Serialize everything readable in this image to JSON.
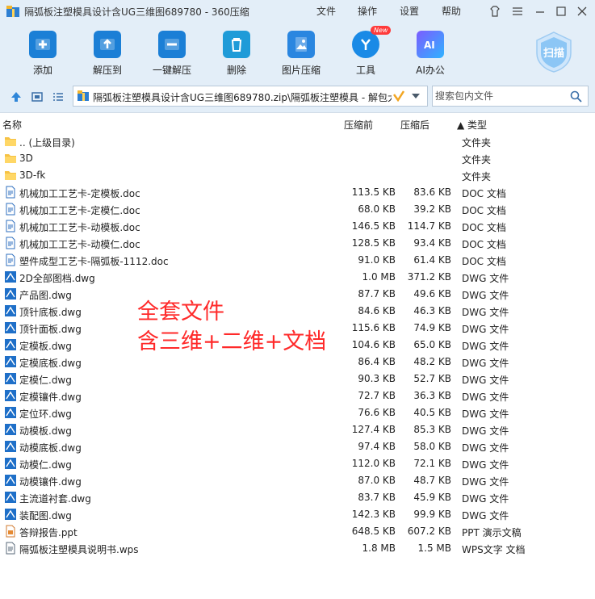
{
  "window": {
    "title": "隔弧板注塑模具设计含UG三维图689780 - 360压缩",
    "menus": [
      "文件",
      "操作",
      "设置",
      "帮助"
    ]
  },
  "toolbar": {
    "items": [
      {
        "label": "添加",
        "icon": "add-archive-icon"
      },
      {
        "label": "解压到",
        "icon": "extract-to-icon"
      },
      {
        "label": "一键解压",
        "icon": "one-click-extract-icon"
      },
      {
        "label": "删除",
        "icon": "delete-icon"
      },
      {
        "label": "图片压缩",
        "icon": "image-compress-icon"
      },
      {
        "label": "工具",
        "icon": "tools-icon",
        "badge": "New"
      },
      {
        "label": "AI办公",
        "icon": "ai-office-icon"
      }
    ],
    "scan_label": "扫描"
  },
  "address": {
    "path": "隔弧板注塑模具设计含UG三维图689780.zip\\隔弧板注塑模具 - 解包大",
    "search_placeholder": "搜索包内文件"
  },
  "columns": {
    "name": "名称",
    "size": "压缩前",
    "compressed": "压缩后",
    "type": "▲ 类型"
  },
  "files": [
    {
      "name": ".. (上级目录)",
      "size": "",
      "csize": "",
      "type": "文件夹",
      "kind": "folder"
    },
    {
      "name": "3D",
      "size": "",
      "csize": "",
      "type": "文件夹",
      "kind": "folder"
    },
    {
      "name": "3D-fk",
      "size": "",
      "csize": "",
      "type": "文件夹",
      "kind": "folder"
    },
    {
      "name": "机械加工工艺卡-定模板.doc",
      "size": "113.5 KB",
      "csize": "83.6 KB",
      "type": "DOC 文档",
      "kind": "doc"
    },
    {
      "name": "机械加工工艺卡-定模仁.doc",
      "size": "68.0 KB",
      "csize": "39.2 KB",
      "type": "DOC 文档",
      "kind": "doc"
    },
    {
      "name": "机械加工工艺卡-动模板.doc",
      "size": "146.5 KB",
      "csize": "114.7 KB",
      "type": "DOC 文档",
      "kind": "doc"
    },
    {
      "name": "机械加工工艺卡-动模仁.doc",
      "size": "128.5 KB",
      "csize": "93.4 KB",
      "type": "DOC 文档",
      "kind": "doc"
    },
    {
      "name": "塑件成型工艺卡-隔弧板-1112.doc",
      "size": "91.0 KB",
      "csize": "61.4 KB",
      "type": "DOC 文档",
      "kind": "doc"
    },
    {
      "name": "2D全部图档.dwg",
      "size": "1.0 MB",
      "csize": "371.2 KB",
      "type": "DWG 文件",
      "kind": "dwg"
    },
    {
      "name": "产品图.dwg",
      "size": "87.7 KB",
      "csize": "49.6 KB",
      "type": "DWG 文件",
      "kind": "dwg"
    },
    {
      "name": "顶针底板.dwg",
      "size": "84.6 KB",
      "csize": "46.3 KB",
      "type": "DWG 文件",
      "kind": "dwg"
    },
    {
      "name": "顶针面板.dwg",
      "size": "115.6 KB",
      "csize": "74.9 KB",
      "type": "DWG 文件",
      "kind": "dwg"
    },
    {
      "name": "定模板.dwg",
      "size": "104.6 KB",
      "csize": "65.0 KB",
      "type": "DWG 文件",
      "kind": "dwg"
    },
    {
      "name": "定模底板.dwg",
      "size": "86.4 KB",
      "csize": "48.2 KB",
      "type": "DWG 文件",
      "kind": "dwg"
    },
    {
      "name": "定模仁.dwg",
      "size": "90.3 KB",
      "csize": "52.7 KB",
      "type": "DWG 文件",
      "kind": "dwg"
    },
    {
      "name": "定模镶件.dwg",
      "size": "72.7 KB",
      "csize": "36.3 KB",
      "type": "DWG 文件",
      "kind": "dwg"
    },
    {
      "name": "定位环.dwg",
      "size": "76.6 KB",
      "csize": "40.5 KB",
      "type": "DWG 文件",
      "kind": "dwg"
    },
    {
      "name": "动模板.dwg",
      "size": "127.4 KB",
      "csize": "85.3 KB",
      "type": "DWG 文件",
      "kind": "dwg"
    },
    {
      "name": "动模底板.dwg",
      "size": "97.4 KB",
      "csize": "58.0 KB",
      "type": "DWG 文件",
      "kind": "dwg"
    },
    {
      "name": "动模仁.dwg",
      "size": "112.0 KB",
      "csize": "72.1 KB",
      "type": "DWG 文件",
      "kind": "dwg"
    },
    {
      "name": "动模镶件.dwg",
      "size": "87.0 KB",
      "csize": "48.7 KB",
      "type": "DWG 文件",
      "kind": "dwg"
    },
    {
      "name": "主流道衬套.dwg",
      "size": "83.7 KB",
      "csize": "45.9 KB",
      "type": "DWG 文件",
      "kind": "dwg"
    },
    {
      "name": "装配图.dwg",
      "size": "142.3 KB",
      "csize": "99.9 KB",
      "type": "DWG 文件",
      "kind": "dwg"
    },
    {
      "name": "答辩报告.ppt",
      "size": "648.5 KB",
      "csize": "607.2 KB",
      "type": "PPT 演示文稿",
      "kind": "ppt"
    },
    {
      "name": "隔弧板注塑模具说明书.wps",
      "size": "1.8 MB",
      "csize": "1.5 MB",
      "type": "WPS文字 文档",
      "kind": "wps"
    }
  ],
  "overlay": {
    "line1": "全套文件",
    "line2": "含三维+二维+文档"
  },
  "colors": {
    "accent": "#1b7fd6",
    "overlay": "#ff2a2a",
    "folder": "#f6c244"
  }
}
